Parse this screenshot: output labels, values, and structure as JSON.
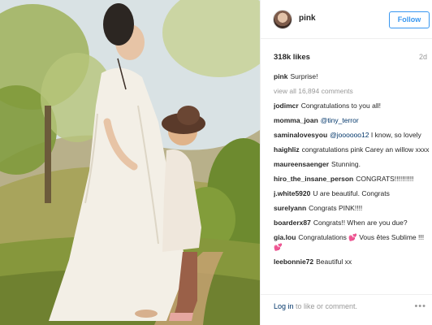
{
  "post": {
    "username": "pink",
    "follow_label": "Follow",
    "likes": "318k likes",
    "age": "2d"
  },
  "caption": {
    "user": "pink",
    "text": "Surprise!"
  },
  "view_all": "view all 16,894 comments",
  "comments": [
    {
      "user": "jodimcr",
      "text": "Congratulations to you all!"
    },
    {
      "user": "momma_joan",
      "mention": "@tiny_terror",
      "text": ""
    },
    {
      "user": "saminalovesyou",
      "mention": "@joooooo12",
      "text": " I know, so lovely"
    },
    {
      "user": "haighliz",
      "text": "congratulations pink Carey an willow xxxx"
    },
    {
      "user": "maureensaenger",
      "text": "Stunning."
    },
    {
      "user": "hiro_the_insane_person",
      "text": "CONGRATS!!!!!!!!!!"
    },
    {
      "user": "j.white5920",
      "text": "U are beautiful. Congrats"
    },
    {
      "user": "surelyann",
      "text": "Congrats PINK!!!!"
    },
    {
      "user": "boarderx87",
      "text": "Congrats!! When are you due?"
    },
    {
      "user": "gia.lou",
      "text": "Congratulations 💕 Vous êtes Sublime !!! 💕"
    },
    {
      "user": "leebonnie72",
      "text": "Beautiful xx"
    }
  ],
  "footer": {
    "login_link": "Log in",
    "login_rest": " to like or comment.",
    "more": "•••"
  },
  "colors": {
    "accent": "#3897f0",
    "link": "#003569",
    "muted": "#999999"
  },
  "icons": {
    "more": "more-options-icon"
  }
}
